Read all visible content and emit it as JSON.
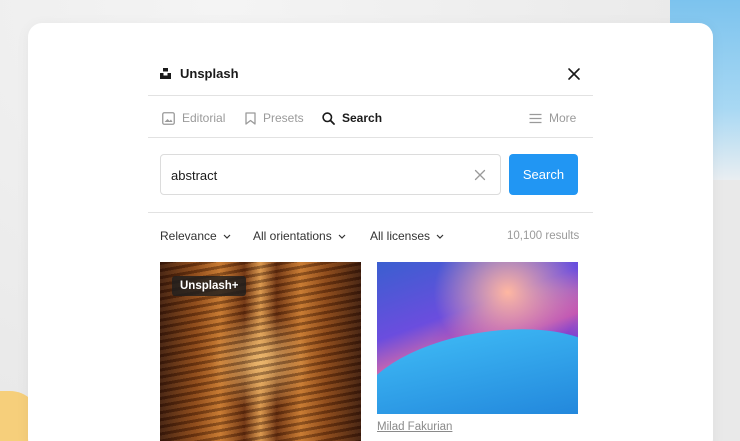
{
  "app": {
    "title": "Unsplash"
  },
  "tabs": [
    {
      "label": "Editorial",
      "icon": "image-icon",
      "active": false
    },
    {
      "label": "Presets",
      "icon": "bookmark-icon",
      "active": false
    },
    {
      "label": "Search",
      "icon": "search-icon",
      "active": true
    }
  ],
  "more": {
    "label": "More",
    "icon": "menu-icon"
  },
  "search": {
    "value": "abstract",
    "button_label": "Search"
  },
  "filters": {
    "sort": "Relevance",
    "orientation": "All orientations",
    "license": "All licenses",
    "results": "10,100 results"
  },
  "images": [
    {
      "badge": "Unsplash+"
    },
    {
      "credit": "Milad Fakurian"
    }
  ],
  "colors": {
    "accent": "#2196f3",
    "text": "#1a1a1a",
    "muted": "#9a9a9a"
  }
}
